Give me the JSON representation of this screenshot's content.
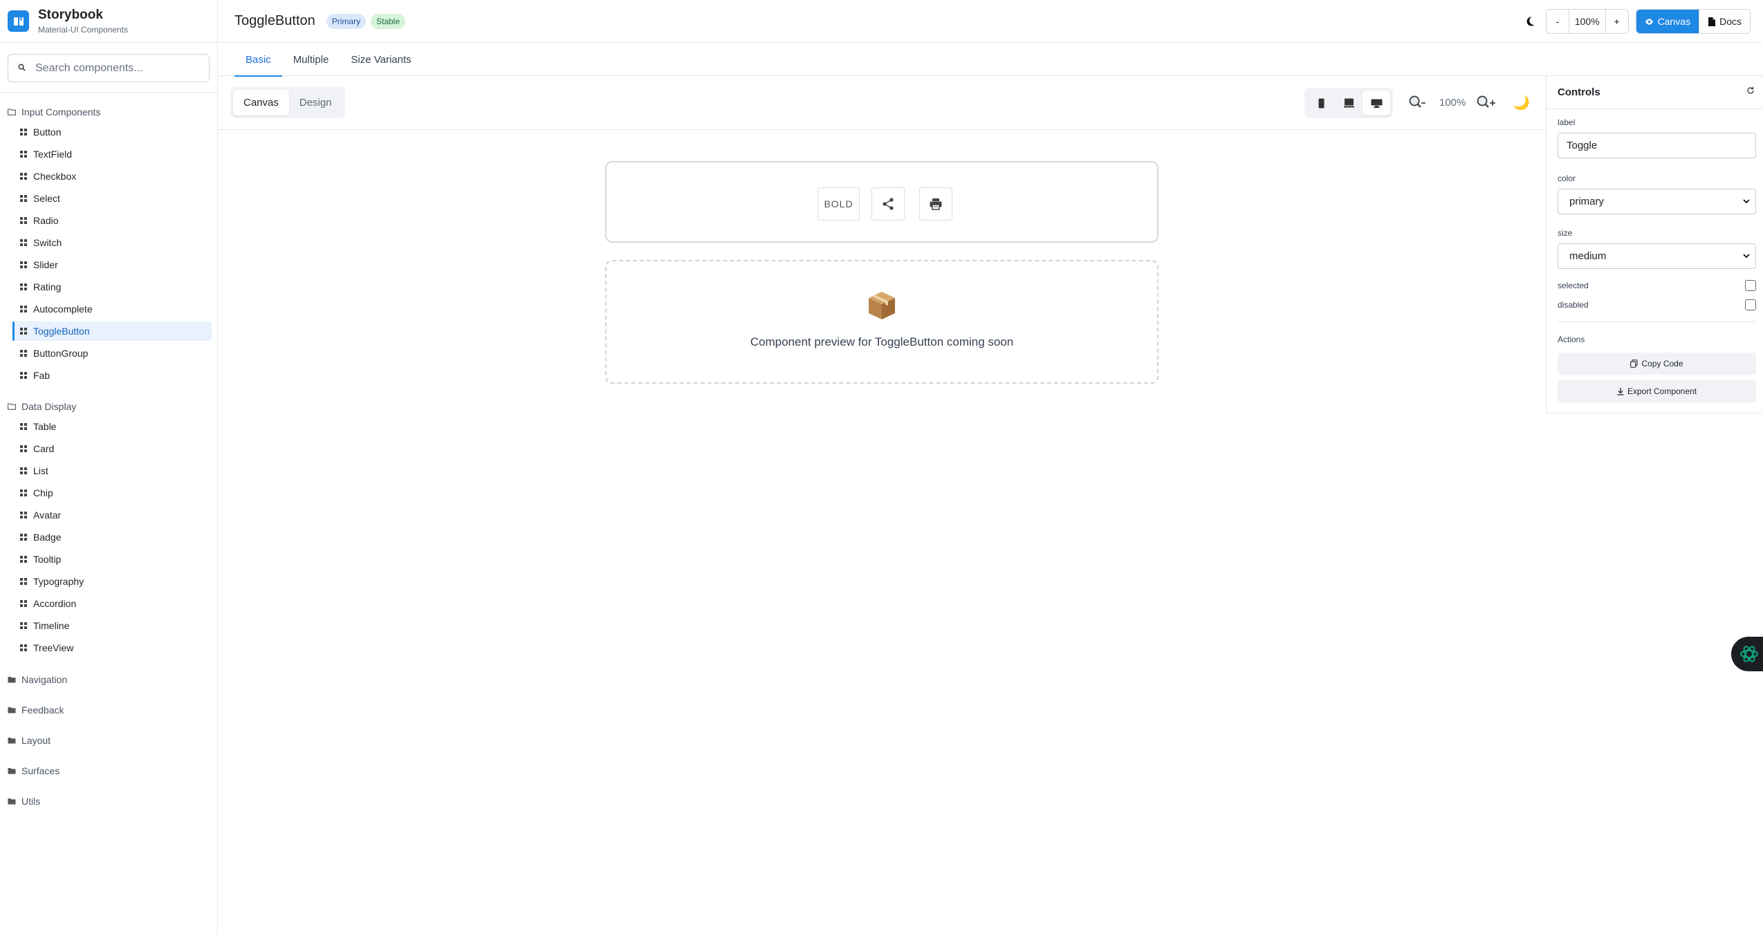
{
  "brand": {
    "title": "Storybook",
    "subtitle": "Material-UI Components"
  },
  "search": {
    "placeholder": "Search components..."
  },
  "sidebar": {
    "groups": [
      {
        "label": "Input Components",
        "items": [
          "Button",
          "TextField",
          "Checkbox",
          "Select",
          "Radio",
          "Switch",
          "Slider",
          "Rating",
          "Autocomplete",
          "ToggleButton",
          "ButtonGroup",
          "Fab"
        ],
        "active": "ToggleButton"
      },
      {
        "label": "Data Display",
        "items": [
          "Table",
          "Card",
          "List",
          "Chip",
          "Avatar",
          "Badge",
          "Tooltip",
          "Typography",
          "Accordion",
          "Timeline",
          "TreeView"
        ]
      }
    ],
    "collapsed": [
      "Navigation",
      "Feedback",
      "Layout",
      "Surfaces",
      "Utils"
    ]
  },
  "header": {
    "title": "ToggleButton",
    "badges": [
      "Primary",
      "Stable"
    ],
    "zoom_minus": "-",
    "zoom_value": "100%",
    "zoom_plus": "+",
    "view_canvas": "Canvas",
    "view_docs": "Docs"
  },
  "tabs": [
    "Basic",
    "Multiple",
    "Size Variants"
  ],
  "toolbar": {
    "mode_canvas": "Canvas",
    "mode_design": "Design",
    "zoom_value": "100%",
    "moon": "🌙"
  },
  "preview": {
    "toggle_bold": "BOLD",
    "package_emoji": "📦",
    "coming_soon": "Component preview for ToggleButton coming soon"
  },
  "controls": {
    "title": "Controls",
    "label_label": "label",
    "label_value": "Toggle",
    "color_label": "color",
    "color_value": "primary",
    "size_label": "size",
    "size_value": "medium",
    "selected_label": "selected",
    "disabled_label": "disabled",
    "actions_label": "Actions",
    "copy_code": "Copy Code",
    "export_component": "Export Component"
  },
  "colors": {
    "accent": "#1e88e5",
    "active_bg": "#e8f1fd",
    "badge_primary": "#dbe8fb",
    "badge_stable": "#d6f3dc"
  }
}
